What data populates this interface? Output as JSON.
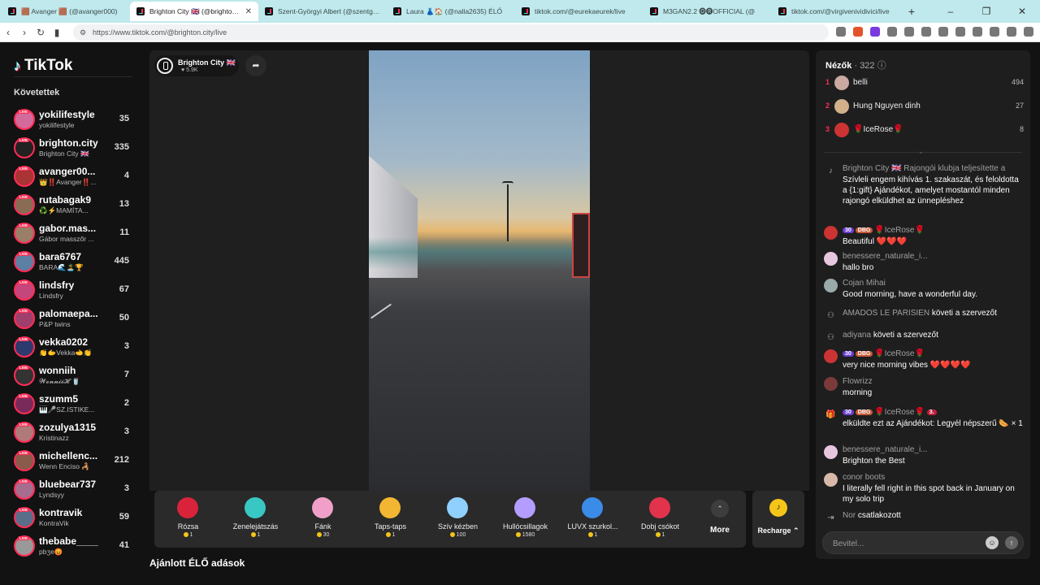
{
  "browser": {
    "tabs": [
      {
        "title": "🟫 Avanger 🟫 (@avanger000)"
      },
      {
        "title": "Brighton City 🇬🇧 (@brighton.city)",
        "active": true
      },
      {
        "title": "Szent-Györgyi Albert (@szentgya1)"
      },
      {
        "title": "Laura 👗🏠 (@nalla2635) ÉLŐ"
      },
      {
        "title": "tiktok.com/@eurekaeurek/live"
      },
      {
        "title": "M3GAN2.2 🅞🅡OFFICIAL (@"
      },
      {
        "title": "tiktok.com/@virgivenividivici/live"
      }
    ],
    "url": "https://www.tiktok.com/@brighton.city/live"
  },
  "sidebar": {
    "logo": "TikTok",
    "following_header": "Követettek",
    "users": [
      {
        "name": "yokilifestyle",
        "sub": "yokilifestyle",
        "count": "35",
        "color": "#d26b9b"
      },
      {
        "name": "brighton.city",
        "sub": "Brighton City 🇬🇧",
        "count": "335",
        "color": "#222"
      },
      {
        "name": "avanger00...",
        "sub": "👑‼️Avanger‼️...",
        "count": "4",
        "color": "#a33"
      },
      {
        "name": "rutabagak9",
        "sub": "♻️⚡MAMÍTA...",
        "count": "13",
        "color": "#8a6c55"
      },
      {
        "name": "gabor.mas...",
        "sub": "Gábor masszőr ...",
        "count": "11",
        "color": "#9a7e68"
      },
      {
        "name": "bara6767",
        "sub": "BARA🌊🏝️🏆",
        "count": "445",
        "color": "#5c7fa3"
      },
      {
        "name": "lindsfry",
        "sub": "Lindsfry",
        "count": "67",
        "color": "#c4467a"
      },
      {
        "name": "palomaepa...",
        "sub": "P&P twins",
        "count": "50",
        "color": "#9f3f6b"
      },
      {
        "name": "vekka0202",
        "sub": "👏🫱Vekka🫲👏",
        "count": "3",
        "color": "#2c3a6e"
      },
      {
        "name": "wonniih",
        "sub": "𝓦𝓸𝓷𝓷𝓲𝓲𝓗 🥤",
        "count": "7",
        "color": "#333"
      },
      {
        "name": "szumm5",
        "sub": "🎹🎤SZ.ISTIKE...",
        "count": "2",
        "color": "#7a2a5a"
      },
      {
        "name": "zozulya1315",
        "sub": "Kristinazz",
        "count": "3",
        "color": "#b07a7a"
      },
      {
        "name": "michellenc...",
        "sub": "Wenn Enciso 🦂",
        "count": "212",
        "color": "#8a5a4a"
      },
      {
        "name": "bluebear737",
        "sub": "Lyndsyy",
        "count": "3",
        "color": "#a76d8f"
      },
      {
        "name": "kontravik",
        "sub": "KontraVik",
        "count": "59",
        "color": "#5a6e8a"
      },
      {
        "name": "thebabe____",
        "sub": "pbʒe😡",
        "count": "41",
        "color": "#999"
      }
    ]
  },
  "stream": {
    "host_name": "Brighton City 🇬🇧",
    "likes": "♥ 5.9K",
    "share_icon": "share-icon"
  },
  "gifts": [
    {
      "name": "Rózsa",
      "price": "1",
      "color": "#d9233a"
    },
    {
      "name": "Zenelejátszás",
      "price": "1",
      "color": "#39c7c4"
    },
    {
      "name": "Fánk",
      "price": "30",
      "color": "#f0a0c8"
    },
    {
      "name": "Taps-taps",
      "price": "1",
      "color": "#f2b632"
    },
    {
      "name": "Szív kézben",
      "price": "100",
      "color": "#8fd0ff"
    },
    {
      "name": "Hullócsillagok",
      "price": "1580",
      "color": "#b39dff"
    },
    {
      "name": "LUVX szurkol...",
      "price": "1",
      "color": "#3b8be8"
    },
    {
      "name": "Dobj csókot",
      "price": "1",
      "color": "#e2334c"
    }
  ],
  "more_label": "More",
  "recharge_label": "Recharge ⌃",
  "recommended_label": "Ajánlott ÉLŐ adások",
  "chat": {
    "viewers_label": "Nézők",
    "viewers_count": "· 322",
    "top_viewers": [
      {
        "rank": "1",
        "name": "belli",
        "score": "494",
        "color": "#c9a9a0"
      },
      {
        "rank": "2",
        "name": "Hung Nguyen dinh",
        "score": "27",
        "color": "#d1b08a"
      },
      {
        "rank": "3",
        "name": "🌹IceRose🌹",
        "score": "8",
        "color": "#c33"
      }
    ],
    "messages": [
      {
        "user": "Brighton City 🇬🇧 Rajongói klubja teljesítette a",
        "text": "Szívleli engem kihívás 1. szakaszát, és feloldotta a {1:gift} Ajándékot, amelyet mostantól minden rajongó elküldhet az ünnepléshez"
      },
      {
        "user": "🌹IceRose🌹",
        "badge1": "30",
        "badge2": "DBG",
        "text": "Beautiful ❤️❤️❤️"
      },
      {
        "user": "benessere_naturale_i...",
        "text": "hallo bro"
      },
      {
        "user": "Cojan Mihai",
        "text": "Good morning, have a wonderful day."
      },
      {
        "user": "AMADOS LE PARISIEN",
        "action": "követi a szervezőt"
      },
      {
        "user": "adiyana",
        "action": "követi a szervezőt"
      },
      {
        "user": "🌹IceRose🌹",
        "badge1": "30",
        "badge2": "DBG",
        "text": "very nice morning vibes ❤️❤️❤️❤️"
      },
      {
        "user": "Flowrizz",
        "text": "morning"
      },
      {
        "user": "🌹IceRose🌹",
        "badge1": "30",
        "badge2": "DBG",
        "badge3": "3.",
        "text": "elküldte ezt az Ajándékot: Legyél népszerű 🌭 × 1"
      },
      {
        "user": "benessere_naturale_i...",
        "text": "Brighton the Best"
      },
      {
        "user": "conor boots",
        "text": "I literally fell right in this spot back in January on my solo trip"
      },
      {
        "user": "Nor",
        "action": "csatlakozott"
      }
    ],
    "input_placeholder": "Bevitel..."
  }
}
